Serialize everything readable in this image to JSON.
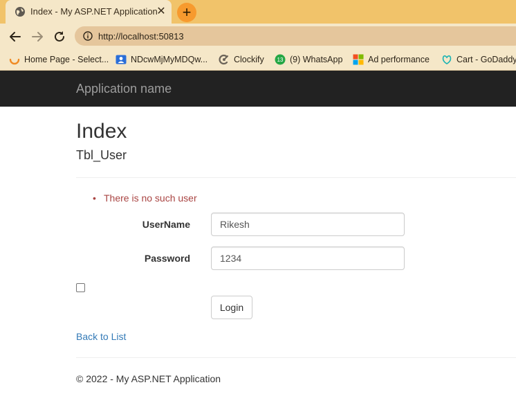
{
  "browser": {
    "tab_title": "Index - My ASP.NET Application",
    "tab_close": "✕",
    "new_tab": "+",
    "url": "http://localhost:50813",
    "bookmarks": [
      {
        "label": "Home Page - Select...",
        "icon": "loader-ring-icon"
      },
      {
        "label": "NDcwMjMyMDQw...",
        "icon": "contact-card-icon"
      },
      {
        "label": "Clockify",
        "icon": "clockify-icon"
      },
      {
        "label": "(9) WhatsApp",
        "icon": "whatsapp-icon",
        "badge": "13"
      },
      {
        "label": "Ad performance",
        "icon": "microsoft-icon"
      },
      {
        "label": "Cart - GoDaddy",
        "icon": "godaddy-icon"
      }
    ]
  },
  "navbar": {
    "brand": "Application name"
  },
  "page": {
    "title": "Index",
    "subtitle": "Tbl_User",
    "validation_bullet": "•",
    "validation_message": "There is no such user",
    "form": {
      "username_label": "UserName",
      "username_value": "Rikesh",
      "password_label": "Password",
      "password_value": "1234",
      "remember_checked": false,
      "submit_label": "Login"
    },
    "back_link": "Back to List",
    "footer": "© 2022 - My ASP.NET Application"
  },
  "colors": {
    "tabstrip": "#f1c36a",
    "toolbar": "#f5e7c8",
    "navbar": "#222222",
    "link": "#337ab7",
    "error": "#a94442"
  }
}
